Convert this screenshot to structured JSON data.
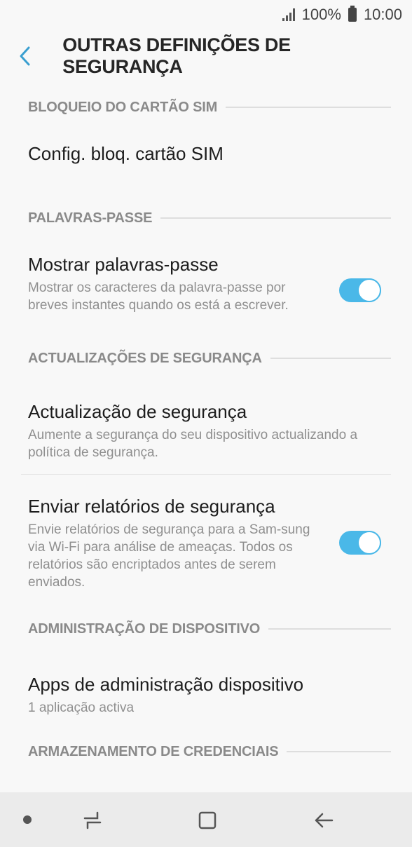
{
  "status_bar": {
    "battery": "100%",
    "time": "10:00"
  },
  "header": {
    "title": "OUTRAS DEFINIÇÕES DE SEGURANÇA"
  },
  "sections": [
    {
      "label": "BLOQUEIO DO CARTÃO SIM"
    },
    {
      "label": "PALAVRAS-PASSE"
    },
    {
      "label": "ACTUALIZAÇÕES DE SEGURANÇA"
    },
    {
      "label": "ADMINISTRAÇÃO DE DISPOSITIVO"
    },
    {
      "label": "ARMAZENAMENTO DE CREDENCIAIS"
    }
  ],
  "items": {
    "sim_lock": {
      "title": "Config. bloq. cartão SIM"
    },
    "show_passwords": {
      "title": "Mostrar palavras-passe",
      "sub": "Mostrar os caracteres da palavra-passe por breves instantes quando os está a escrever.",
      "enabled": true
    },
    "security_update": {
      "title": "Actualização de segurança",
      "sub": "Aumente a segurança do seu dispositivo actualizando a política de segurança."
    },
    "send_reports": {
      "title": "Enviar relatórios de segurança",
      "sub": "Envie relatórios de segurança para a Sam-sung via Wi-Fi para análise de ameaças. Todos os relatórios são encriptados antes de serem enviados.",
      "enabled": true
    },
    "device_admin": {
      "title": "Apps de administração dispositivo",
      "sub": "1 aplicação activa"
    }
  },
  "colors": {
    "accent": "#4ab8e8",
    "section_label": "#8a8a8a",
    "background": "#f8f8f8",
    "nav_bar": "#ebebeb"
  },
  "icons": {
    "back": "chevron-left-icon",
    "recents": "recents-icon",
    "home": "home-icon",
    "nav_back": "back-arrow-icon"
  }
}
